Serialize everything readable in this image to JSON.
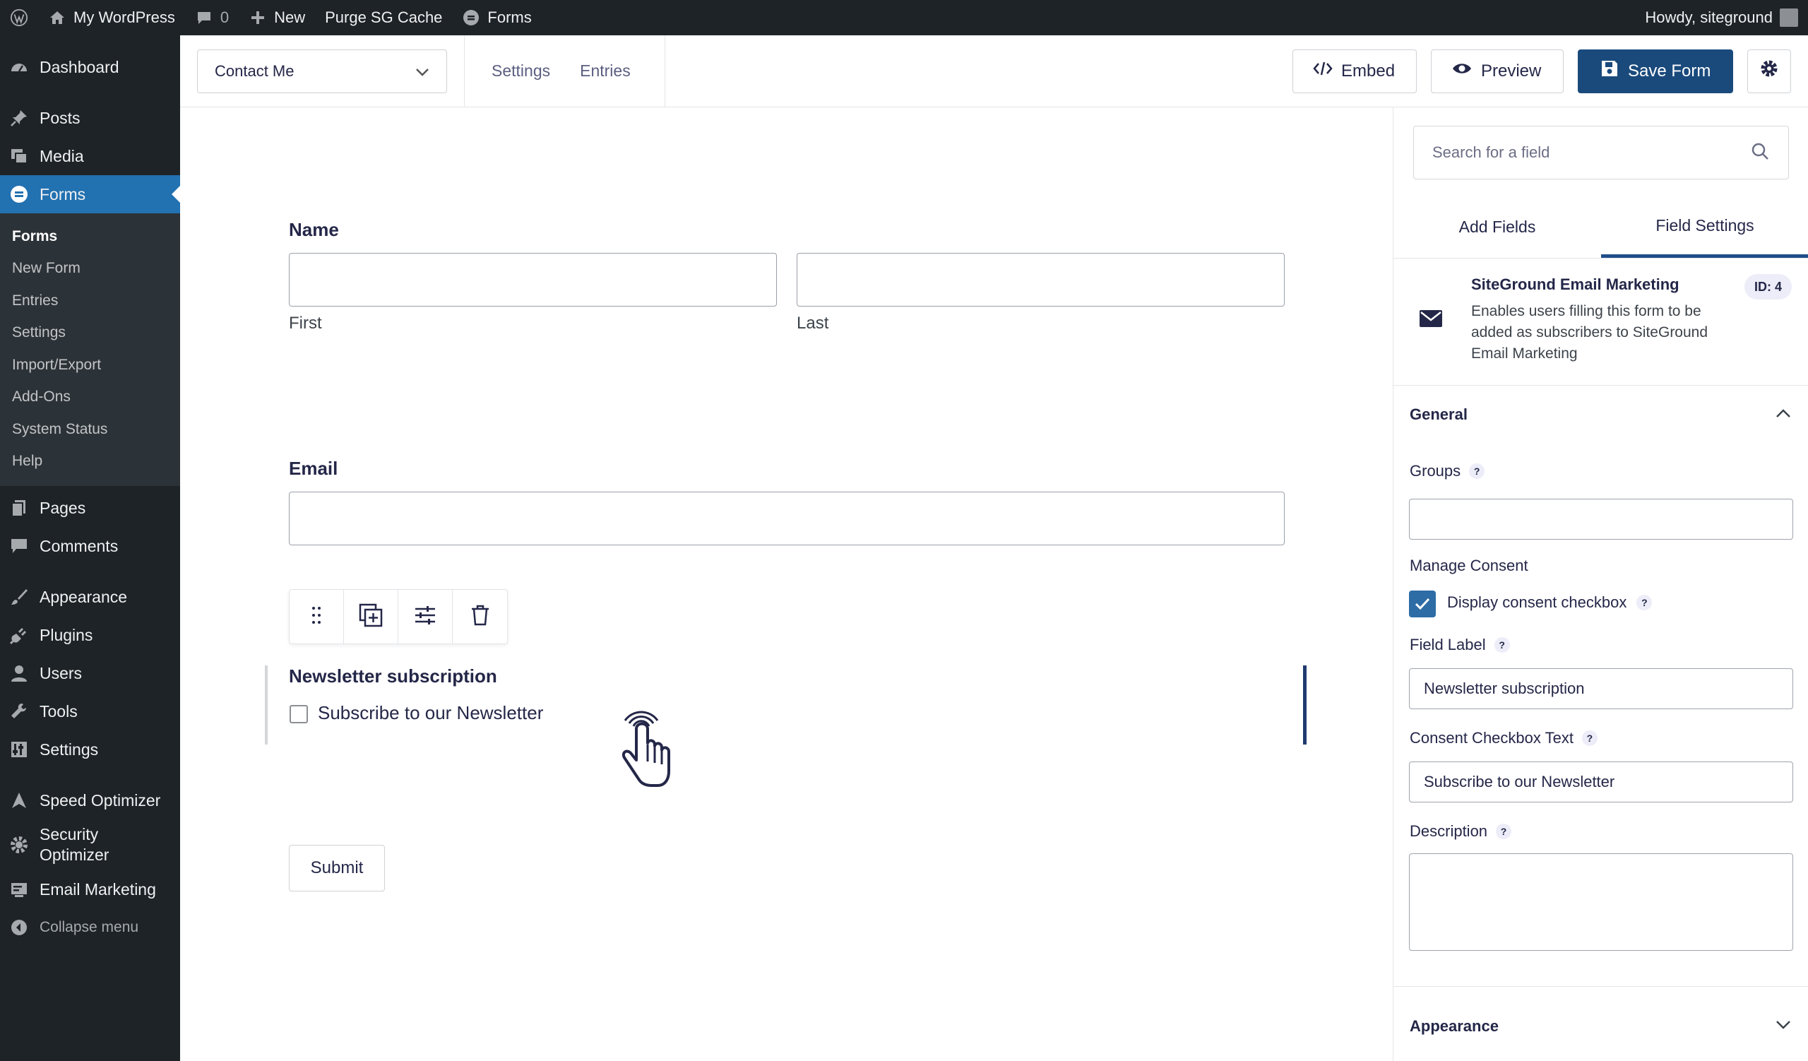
{
  "admin_bar": {
    "site_name": "My WordPress",
    "comments_count": "0",
    "new_label": "New",
    "purge_label": "Purge SG Cache",
    "forms_label": "Forms",
    "greeting": "Howdy, siteground"
  },
  "sidebar": {
    "dashboard": "Dashboard",
    "posts": "Posts",
    "media": "Media",
    "forms": "Forms",
    "submenu": [
      "Forms",
      "New Form",
      "Entries",
      "Settings",
      "Import/Export",
      "Add-Ons",
      "System Status",
      "Help"
    ],
    "pages": "Pages",
    "comments": "Comments",
    "appearance": "Appearance",
    "plugins": "Plugins",
    "users": "Users",
    "tools": "Tools",
    "settings": "Settings",
    "speed_optimizer": "Speed Optimizer",
    "security_optimizer_1": "Security",
    "security_optimizer_2": "Optimizer",
    "email_marketing": "Email Marketing",
    "collapse": "Collapse menu"
  },
  "toolbar": {
    "form_name": "Contact Me",
    "settings_link": "Settings",
    "entries_link": "Entries",
    "embed": "Embed",
    "preview": "Preview",
    "save": "Save Form"
  },
  "form": {
    "name_label": "Name",
    "first_label": "First",
    "last_label": "Last",
    "email_label": "Email",
    "newsletter_label": "Newsletter subscription",
    "newsletter_checkbox": "Subscribe to our Newsletter",
    "submit": "Submit"
  },
  "panel": {
    "search_placeholder": "Search for a field",
    "tab_add": "Add Fields",
    "tab_settings": "Field Settings",
    "addon_title": "SiteGround Email Marketing",
    "addon_desc": "Enables users filling this form to be added as subscribers to SiteGround Email Marketing",
    "id_badge": "ID: 4",
    "general": "General",
    "groups": "Groups",
    "manage_consent": "Manage Consent",
    "display_consent": "Display consent checkbox",
    "field_label": "Field Label",
    "field_label_value": "Newsletter subscription",
    "consent_text": "Consent Checkbox Text",
    "consent_text_value": "Subscribe to our Newsletter",
    "description": "Description",
    "appearance": "Appearance",
    "help_mark": "?"
  },
  "colors": {
    "admin_bg": "#1d2327",
    "active_menu": "#2271b1",
    "primary_button": "#1a4a7c",
    "checkbox_checked": "#2e6ca5"
  }
}
